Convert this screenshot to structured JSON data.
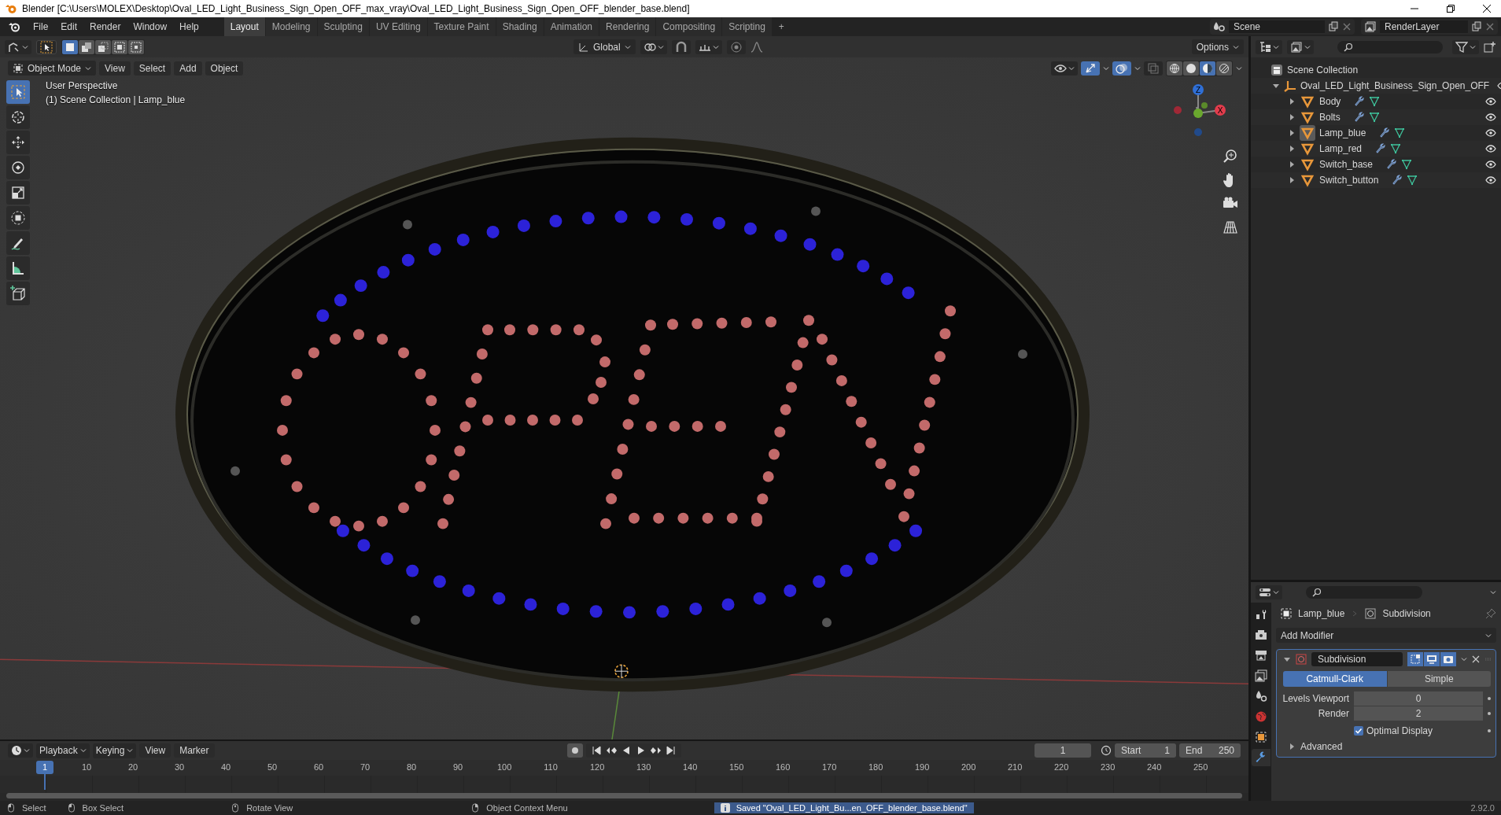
{
  "window": {
    "title": "Blender [C:\\Users\\MOLEX\\Desktop\\Oval_LED_Light_Business_Sign_Open_OFF_max_vray\\Oval_LED_Light_Business_Sign_Open_OFF_blender_base.blend]"
  },
  "menu": [
    "File",
    "Edit",
    "Render",
    "Window",
    "Help"
  ],
  "workspace_tabs": [
    {
      "label": "Layout",
      "selected": true
    },
    {
      "label": "Modeling",
      "selected": false
    },
    {
      "label": "Sculpting",
      "selected": false
    },
    {
      "label": "UV Editing",
      "selected": false
    },
    {
      "label": "Texture Paint",
      "selected": false
    },
    {
      "label": "Shading",
      "selected": false
    },
    {
      "label": "Animation",
      "selected": false
    },
    {
      "label": "Rendering",
      "selected": false
    },
    {
      "label": "Compositing",
      "selected": false
    },
    {
      "label": "Scripting",
      "selected": false
    }
  ],
  "add_tab": "+",
  "scene": {
    "name": "Scene"
  },
  "view_layer": {
    "name": "RenderLayer"
  },
  "viewport": {
    "orientation": "Global",
    "options": "Options",
    "mode": "Object Mode",
    "menus": [
      "View",
      "Select",
      "Add",
      "Object"
    ],
    "select_modes": [
      {
        "kind": "set",
        "selected": true
      },
      {
        "kind": "extend",
        "selected": false
      },
      {
        "kind": "subtract",
        "selected": false
      },
      {
        "kind": "invert",
        "selected": false
      },
      {
        "kind": "intersect",
        "selected": false
      }
    ],
    "gizmos_on": true,
    "overlays_on": true,
    "shading_modes": [
      {
        "kind": "wireframe",
        "selected": false
      },
      {
        "kind": "solid",
        "selected": false
      },
      {
        "kind": "material",
        "selected": true
      },
      {
        "kind": "rendered",
        "selected": false
      }
    ],
    "overlay_lines": [
      "User Perspective",
      "(1) Scene Collection | Lamp_blue"
    ],
    "tools": [
      {
        "kind": "select",
        "selected": true
      },
      {
        "kind": "cursor",
        "selected": false
      },
      {
        "kind": "move",
        "selected": false
      },
      {
        "kind": "rotate",
        "selected": false
      },
      {
        "kind": "scale",
        "selected": false
      },
      {
        "kind": "transform",
        "selected": false
      },
      {
        "kind": "annotate",
        "selected": false
      },
      {
        "kind": "measure",
        "selected": false
      },
      {
        "kind": "add-cube",
        "selected": false
      }
    ],
    "axis_labels": {
      "z": "Z",
      "x": "X"
    }
  },
  "outliner": {
    "root": {
      "label": "Scene Collection",
      "children": [
        {
          "label": "Oval_LED_Light_Business_Sign_Open_OFF",
          "expanded": true,
          "children": [
            {
              "label": "Body",
              "selected": false
            },
            {
              "label": "Bolts",
              "selected": false
            },
            {
              "label": "Lamp_blue",
              "selected": true
            },
            {
              "label": "Lamp_red",
              "selected": false
            },
            {
              "label": "Switch_base",
              "selected": false
            },
            {
              "label": "Switch_button",
              "selected": false
            }
          ]
        }
      ]
    }
  },
  "properties": {
    "tabs": [
      {
        "kind": "tool",
        "selected": false
      },
      {
        "kind": "render",
        "selected": false
      },
      {
        "kind": "output",
        "selected": false
      },
      {
        "kind": "view-layer",
        "selected": false
      },
      {
        "kind": "scene",
        "selected": false
      },
      {
        "kind": "world",
        "selected": false
      },
      {
        "kind": "object",
        "selected": false
      },
      {
        "kind": "modifiers",
        "selected": true
      }
    ],
    "breadcrumb": [
      "Lamp_blue",
      "Subdivision"
    ],
    "add_modifier": "Add Modifier",
    "modifier": {
      "name": "Subdivision",
      "expanded": true,
      "toggles": [
        {
          "kind": "edit-mode",
          "on": true
        },
        {
          "kind": "viewport",
          "on": true
        },
        {
          "kind": "render",
          "on": true
        }
      ],
      "types": [
        {
          "label": "Catmull-Clark",
          "selected": true
        },
        {
          "label": "Simple",
          "selected": false
        }
      ],
      "fields": [
        {
          "label": "Levels Viewport",
          "value": "0"
        },
        {
          "label": "Render",
          "value": "2"
        }
      ],
      "optimal_display": {
        "label": "Optimal Display",
        "checked": true
      },
      "advanced": {
        "label": "Advanced",
        "expanded": false
      }
    }
  },
  "timeline": {
    "menus": [
      "Playback",
      "Keying",
      "View",
      "Marker"
    ],
    "current_frame": "1",
    "start": {
      "label": "Start",
      "value": "1"
    },
    "end": {
      "label": "End",
      "value": "250"
    },
    "ruler": {
      "current": "1",
      "ticks": [
        "10",
        "20",
        "30",
        "40",
        "50",
        "60",
        "70",
        "80",
        "90",
        "100",
        "110",
        "120",
        "130",
        "140",
        "150",
        "160",
        "170",
        "180",
        "190",
        "200",
        "210",
        "220",
        "230",
        "240",
        "250"
      ]
    }
  },
  "status_bar": {
    "hints": [
      {
        "kind": "left",
        "label": "Select"
      },
      {
        "kind": "left",
        "label": "Box Select"
      },
      {
        "kind": "middle",
        "label": "Rotate View"
      },
      {
        "kind": "right",
        "label": "Object Context Menu"
      }
    ],
    "message": "Saved \"Oval_LED_Light_Bu...en_OFF_blender_base.blend\"",
    "version": "2.92.0"
  }
}
